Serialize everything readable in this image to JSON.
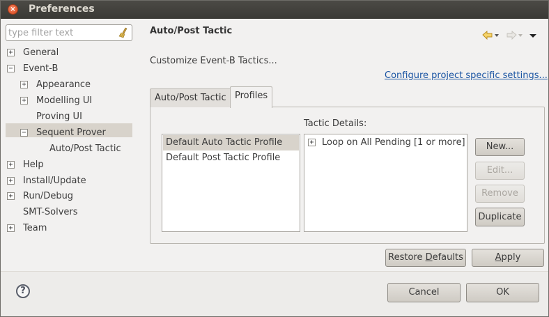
{
  "window": {
    "title": "Preferences"
  },
  "filter": {
    "placeholder": "type filter text"
  },
  "tree": {
    "items": [
      {
        "label": "General",
        "toggle": "+"
      },
      {
        "label": "Event-B",
        "toggle": "−"
      },
      {
        "label": "Appearance",
        "toggle": "+"
      },
      {
        "label": "Modelling UI",
        "toggle": "+"
      },
      {
        "label": "Proving UI",
        "toggle": ""
      },
      {
        "label": "Sequent Prover",
        "toggle": "−"
      },
      {
        "label": "Auto/Post Tactic",
        "toggle": ""
      },
      {
        "label": "Help",
        "toggle": "+"
      },
      {
        "label": "Install/Update",
        "toggle": "+"
      },
      {
        "label": "Run/Debug",
        "toggle": "+"
      },
      {
        "label": "SMT-Solvers",
        "toggle": ""
      },
      {
        "label": "Team",
        "toggle": "+"
      }
    ],
    "selected": "Auto/Post Tactic"
  },
  "page": {
    "title": "Auto/Post Tactic",
    "description": "Customize Event-B Tactics...",
    "link": "Configure project specific settings..."
  },
  "tabs": [
    {
      "label": "Auto/Post Tactic",
      "active": false
    },
    {
      "label": "Profiles",
      "active": true
    }
  ],
  "profiles": {
    "items": [
      "Default Auto Tactic Profile",
      "Default Post Tactic Profile"
    ],
    "selected": "Default Auto Tactic Profile"
  },
  "details": {
    "label": "Tactic Details:",
    "items": [
      {
        "label": "Loop on All Pending [1 or more]",
        "toggle": "+"
      }
    ]
  },
  "buttons": {
    "new": "New...",
    "edit": "Edit...",
    "remove": "Remove",
    "duplicate": "Duplicate",
    "restore_prefix": "Restore ",
    "restore_mnemonic": "D",
    "restore_suffix": "efaults",
    "apply_mnemonic": "A",
    "apply_suffix": "pply",
    "cancel": "Cancel",
    "ok": "OK"
  },
  "help": {
    "glyph": "?"
  },
  "titlebar_close_glyph": "×",
  "colors": {
    "titlebar": "#3c3b37",
    "selection": "#d8d3cb",
    "link": "#1b55a3",
    "close": "#e2522b"
  },
  "icons": [
    "close-icon",
    "broom-clear-icon",
    "back-arrow-icon",
    "forward-arrow-icon",
    "view-menu-icon",
    "help-icon"
  ]
}
